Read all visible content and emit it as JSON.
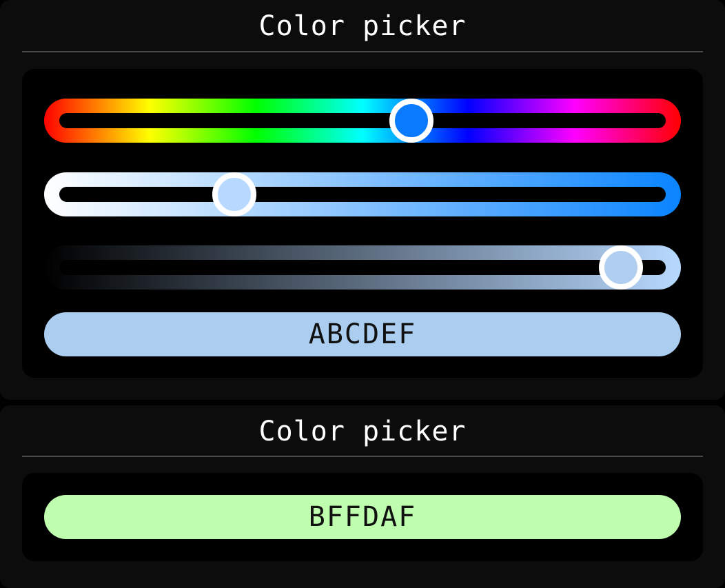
{
  "picker1": {
    "title": "Color picker",
    "hue": {
      "value": 0.577,
      "knob_color": "#0a7bff"
    },
    "saturation": {
      "value": 0.299,
      "knob_color": "#b8d9ff",
      "end_color": "#0a84ff"
    },
    "brightness": {
      "value": 0.906,
      "knob_color": "#b0cff0",
      "end_color": "#b8d9ff"
    },
    "hex_label": "ABCDEF",
    "swatch_color": "#abcdef"
  },
  "picker2": {
    "title": "Color picker",
    "hex_label": "BFFDAF",
    "swatch_color": "#bffdaf"
  }
}
